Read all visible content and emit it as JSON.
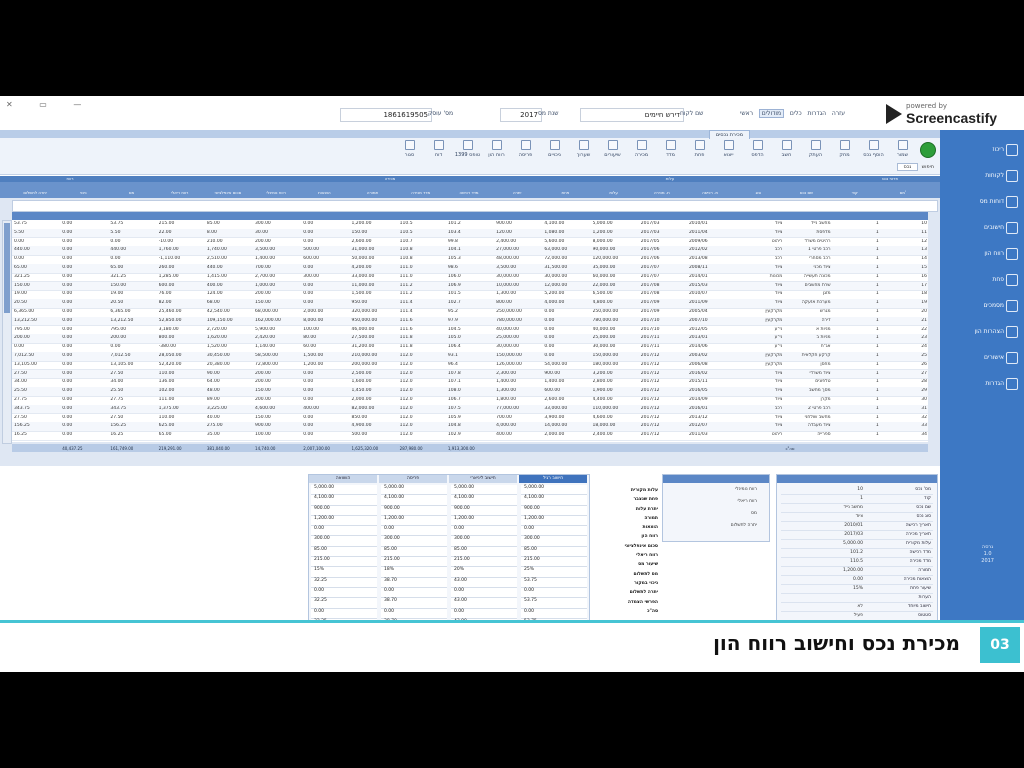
{
  "title_bar": {
    "field_id_label": "מס' עוסק",
    "field_id_value": "1861619505",
    "field_year_label": "שנת מס",
    "field_year_value": "2017",
    "field_name_label": "שם לקוח",
    "field_name_value": "דירש חיימים",
    "menu": [
      "ראשי",
      "מודולים",
      "כלים",
      "הגדרות",
      "עזרה"
    ]
  },
  "logo": {
    "small": "powered by",
    "big": "Screencastify"
  },
  "sidebar": {
    "items": [
      "ריכוז",
      "לקוחות",
      "דוחות מס",
      "חישובים",
      "רווח הון",
      "פחת",
      "מסמכים",
      "הצהרות הון",
      "אישורים",
      "הגדרות"
    ],
    "footer": [
      "גרסה",
      "1.0",
      "2017"
    ]
  },
  "ribbon": {
    "active_tab": "מכירת נכסים",
    "buttons": [
      "שמור",
      "הוסף נכס",
      "מחק",
      "העתק",
      "חשב",
      "הדפס",
      "ייצוא",
      "פחת",
      "מדד",
      "מכירה",
      "שיעורים",
      "שערוך",
      "ניכויים",
      "פריסה",
      "רווח הון",
      "טופס 1399",
      "דוח",
      "סגור"
    ],
    "search_label": "חיפוש",
    "search_value": "נכס"
  },
  "grid": {
    "group_headers": [
      "פרטי נכס",
      "עלות",
      "מכירה",
      "רווח"
    ],
    "columns": [
      "מס'",
      "קוד",
      "שם נכס",
      "סוג",
      "ת. רכישה",
      "ת. מכירה",
      "עלות",
      "פחת",
      "יתרה",
      "מדד רכישה",
      "מדד מכירה",
      "תמורה",
      "הוצאות",
      "רווח נומינלי",
      "סכום אינפלציוני",
      "רווח ריאלי",
      "מס",
      "ניכוי",
      "יתרה לתשלום"
    ],
    "rows": [
      [
        "10",
        "1",
        "מחשב נייד",
        "ציוד",
        "2010/01",
        "2017/03",
        "5,000.00",
        "4,100.00",
        "900.00",
        "101.2",
        "110.5",
        "1,200.00",
        "0.00",
        "300.00",
        "85.00",
        "215.00",
        "53.75",
        "0.00",
        "53.75"
      ],
      [
        "11",
        "1",
        "מדפסת",
        "ציוד",
        "2011/04",
        "2017/03",
        "1,200.00",
        "1,080.00",
        "120.00",
        "103.4",
        "110.5",
        "150.00",
        "0.00",
        "30.00",
        "8.00",
        "22.00",
        "5.50",
        "0.00",
        "5.50"
      ],
      [
        "12",
        "1",
        "רהיטים משרד",
        "ריהוט",
        "2009/06",
        "2017/05",
        "8,000.00",
        "5,600.00",
        "2,400.00",
        "99.8",
        "110.7",
        "2,600.00",
        "0.00",
        "200.00",
        "210.00",
        "-10.00",
        "0.00",
        "0.00",
        "0.00"
      ],
      [
        "13",
        "1",
        "רכב פרטי 1",
        "רכב",
        "2012/02",
        "2017/06",
        "90,000.00",
        "63,000.00",
        "27,000.00",
        "104.1",
        "110.8",
        "31,000.00",
        "500.00",
        "3,500.00",
        "1,740.00",
        "1,760.00",
        "440.00",
        "0.00",
        "440.00"
      ],
      [
        "14",
        "1",
        "רכב מסחרי",
        "רכב",
        "2013/08",
        "2017/06",
        "120,000.00",
        "72,000.00",
        "48,000.00",
        "105.3",
        "110.8",
        "50,000.00",
        "600.00",
        "1,400.00",
        "2,510.00",
        "-1,110.00",
        "0.00",
        "0.00",
        "0.00"
      ],
      [
        "15",
        "1",
        "ציוד מכני",
        "ציוד",
        "2008/11",
        "2017/07",
        "35,000.00",
        "31,500.00",
        "3,500.00",
        "98.6",
        "111.0",
        "4,200.00",
        "0.00",
        "700.00",
        "440.00",
        "260.00",
        "65.00",
        "0.00",
        "65.00"
      ],
      [
        "16",
        "1",
        "מכונה תעשייה",
        "מכונות",
        "2014/01",
        "2017/07",
        "60,000.00",
        "30,000.00",
        "30,000.00",
        "106.0",
        "111.0",
        "33,000.00",
        "300.00",
        "2,700.00",
        "1,415.00",
        "1,285.00",
        "321.25",
        "0.00",
        "321.25"
      ],
      [
        "17",
        "1",
        "שרת מחשבים",
        "ציוד",
        "2015/03",
        "2017/08",
        "22,000.00",
        "12,000.00",
        "10,000.00",
        "106.9",
        "111.2",
        "11,000.00",
        "0.00",
        "1,000.00",
        "400.00",
        "600.00",
        "150.00",
        "0.00",
        "150.00"
      ],
      [
        "18",
        "1",
        "מזגן",
        "ציוד",
        "2010/07",
        "2017/08",
        "6,500.00",
        "5,200.00",
        "1,300.00",
        "101.5",
        "111.2",
        "1,500.00",
        "0.00",
        "200.00",
        "124.00",
        "76.00",
        "19.00",
        "0.00",
        "19.00"
      ],
      [
        "19",
        "1",
        "מערכת אזעקה",
        "ציוד",
        "2011/09",
        "2017/09",
        "4,800.00",
        "4,000.00",
        "800.00",
        "102.7",
        "111.4",
        "950.00",
        "0.00",
        "150.00",
        "68.00",
        "82.00",
        "20.50",
        "0.00",
        "20.50"
      ],
      [
        "20",
        "1",
        "מגרש",
        "מקרקעין",
        "2005/04",
        "2017/09",
        "250,000.00",
        "0.00",
        "250,000.00",
        "95.2",
        "111.4",
        "320,000.00",
        "2,000.00",
        "68,000.00",
        "42,540.00",
        "25,460.00",
        "6,365.00",
        "0.00",
        "6,365.00"
      ],
      [
        "21",
        "1",
        "דירה",
        "מקרקעין",
        "2007/10",
        "2017/10",
        "780,000.00",
        "0.00",
        "780,000.00",
        "97.9",
        "111.6",
        "950,000.00",
        "8,000.00",
        "162,000.00",
        "109,150.00",
        "52,850.00",
        "13,212.50",
        "0.00",
        "13,212.50"
      ],
      [
        "22",
        "1",
        "מניות א",
        "ני\"ע",
        "2012/05",
        "2017/10",
        "40,000.00",
        "0.00",
        "40,000.00",
        "104.5",
        "111.6",
        "46,000.00",
        "100.00",
        "5,900.00",
        "2,720.00",
        "3,180.00",
        "795.00",
        "0.00",
        "795.00"
      ],
      [
        "23",
        "1",
        "מניות ב",
        "ני\"ע",
        "2013/01",
        "2017/11",
        "25,000.00",
        "0.00",
        "25,000.00",
        "105.0",
        "111.8",
        "27,500.00",
        "80.00",
        "2,420.00",
        "1,620.00",
        "800.00",
        "200.00",
        "0.00",
        "200.00"
      ],
      [
        "24",
        "1",
        "אג\"ח",
        "ני\"ע",
        "2014/06",
        "2017/11",
        "30,000.00",
        "0.00",
        "30,000.00",
        "106.4",
        "111.8",
        "31,200.00",
        "60.00",
        "1,140.00",
        "1,520.00",
        "-380.00",
        "0.00",
        "0.00",
        "0.00"
      ],
      [
        "25",
        "1",
        "קרקע חקלאית",
        "מקרקעין",
        "2003/02",
        "2017/12",
        "150,000.00",
        "0.00",
        "150,000.00",
        "93.1",
        "112.0",
        "210,000.00",
        "1,500.00",
        "58,500.00",
        "30,450.00",
        "28,050.00",
        "7,012.50",
        "0.00",
        "7,012.50"
      ],
      [
        "26",
        "1",
        "מחסן",
        "מקרקעין",
        "2006/08",
        "2017/12",
        "180,000.00",
        "54,000.00",
        "126,000.00",
        "96.4",
        "112.0",
        "200,000.00",
        "1,200.00",
        "72,800.00",
        "20,380.00",
        "52,420.00",
        "13,105.00",
        "0.00",
        "13,105.00"
      ],
      [
        "27",
        "1",
        "ציוד משרדי",
        "ציוד",
        "2016/02",
        "2017/12",
        "3,200.00",
        "900.00",
        "2,300.00",
        "107.8",
        "112.0",
        "2,500.00",
        "0.00",
        "200.00",
        "90.00",
        "110.00",
        "27.50",
        "0.00",
        "27.50"
      ],
      [
        "28",
        "1",
        "טלפונים",
        "ציוד",
        "2015/11",
        "2017/12",
        "2,800.00",
        "1,400.00",
        "1,400.00",
        "107.1",
        "112.0",
        "1,600.00",
        "0.00",
        "200.00",
        "64.00",
        "136.00",
        "34.00",
        "0.00",
        "34.00"
      ],
      [
        "29",
        "1",
        "מסך מחשב",
        "ציוד",
        "2016/05",
        "2017/12",
        "1,900.00",
        "600.00",
        "1,300.00",
        "108.0",
        "112.0",
        "1,450.00",
        "0.00",
        "150.00",
        "48.00",
        "102.00",
        "25.50",
        "0.00",
        "25.50"
      ],
      [
        "30",
        "1",
        "מקרן",
        "ציוד",
        "2014/09",
        "2017/12",
        "4,400.00",
        "2,600.00",
        "1,800.00",
        "106.7",
        "112.0",
        "2,000.00",
        "0.00",
        "200.00",
        "89.00",
        "111.00",
        "27.75",
        "0.00",
        "27.75"
      ],
      [
        "31",
        "1",
        "רכב פרטי 2",
        "רכב",
        "2016/01",
        "2017/12",
        "110,000.00",
        "33,000.00",
        "77,000.00",
        "107.5",
        "112.0",
        "82,000.00",
        "400.00",
        "4,600.00",
        "3,225.00",
        "1,375.00",
        "343.75",
        "0.00",
        "343.75"
      ],
      [
        "32",
        "1",
        "מחשב שולחני",
        "ציוד",
        "2013/12",
        "2017/12",
        "4,600.00",
        "3,900.00",
        "700.00",
        "105.9",
        "112.0",
        "850.00",
        "0.00",
        "150.00",
        "40.00",
        "110.00",
        "27.50",
        "0.00",
        "27.50"
      ],
      [
        "33",
        "1",
        "ציוד מעבדה",
        "ציוד",
        "2012/07",
        "2017/12",
        "18,000.00",
        "14,000.00",
        "4,000.00",
        "104.8",
        "112.0",
        "4,900.00",
        "0.00",
        "900.00",
        "275.00",
        "625.00",
        "156.25",
        "0.00",
        "156.25"
      ],
      [
        "34",
        "1",
        "ספרייה",
        "ריהוט",
        "2011/03",
        "2017/12",
        "2,400.00",
        "2,000.00",
        "400.00",
        "102.9",
        "112.0",
        "500.00",
        "0.00",
        "100.00",
        "35.00",
        "65.00",
        "16.25",
        "0.00",
        "16.25"
      ]
    ],
    "totals": [
      "סה\"כ",
      "1,913,300.00",
      "287,980.00",
      "1,625,320.00",
      "2,007,100.00",
      "14,740.00",
      "381,040.00",
      "219,291.00",
      "161,749.00",
      "40,437.25"
    ]
  },
  "details_panel": {
    "rows": [
      {
        "k": "מס' נכס",
        "v": "10"
      },
      {
        "k": "קוד",
        "v": "1"
      },
      {
        "k": "שם נכס",
        "v": "מחשב נייד"
      },
      {
        "k": "סוג נכס",
        "v": "ציוד"
      },
      {
        "k": "תאריך רכישה",
        "v": "2010/01"
      },
      {
        "k": "תאריך מכירה",
        "v": "2017/03"
      },
      {
        "k": "עלות מקורית",
        "v": "5,000.00"
      },
      {
        "k": "מדד רכישה",
        "v": "101.2"
      },
      {
        "k": "מדד מכירה",
        "v": "110.5"
      },
      {
        "k": "תמורה",
        "v": "1,200.00"
      },
      {
        "k": "הוצאות מכירה",
        "v": "0.00"
      },
      {
        "k": "שיעור פחת",
        "v": "15%"
      },
      {
        "k": "הערות",
        "v": ""
      },
      {
        "k": "חישוב מיוחד",
        "v": "לא"
      },
      {
        "k": "סטטוס",
        "v": "פעיל"
      }
    ]
  },
  "mid_panel": {
    "lines": [
      "רווח נומינלי",
      "רווח ריאלי",
      "מס",
      "יתרה לתשלום"
    ]
  },
  "calc_labels": [
    "עלות מקורית",
    "פחת שנצבר",
    "יתרת עלות",
    "תמורה",
    "הוצאות",
    "רווח הון",
    "סכום אינפלציוני",
    "רווח ריאלי",
    "שיעור מס",
    "מס לתשלום",
    "ניכוי במקור",
    "יתרה לתשלום",
    "הפרשי הצמדה",
    "סה\"כ"
  ],
  "compare_panel": {
    "tabs": [
      "חישוב רגיל",
      "חישוב ליניארי",
      "פריסה",
      "השוואה"
    ],
    "columns": [
      [
        "5,000.00",
        "4,100.00",
        "900.00",
        "1,200.00",
        "0.00",
        "300.00",
        "85.00",
        "215.00",
        "25%",
        "53.75",
        "0.00",
        "53.75",
        "0.00",
        "53.75"
      ],
      [
        "5,000.00",
        "4,100.00",
        "900.00",
        "1,200.00",
        "0.00",
        "300.00",
        "85.00",
        "215.00",
        "20%",
        "43.00",
        "0.00",
        "43.00",
        "0.00",
        "43.00"
      ],
      [
        "5,000.00",
        "4,100.00",
        "900.00",
        "1,200.00",
        "0.00",
        "300.00",
        "85.00",
        "215.00",
        "18%",
        "38.70",
        "0.00",
        "38.70",
        "0.00",
        "38.70"
      ],
      [
        "5,000.00",
        "4,100.00",
        "900.00",
        "1,200.00",
        "0.00",
        "300.00",
        "85.00",
        "215.00",
        "15%",
        "32.25",
        "0.00",
        "32.25",
        "0.00",
        "32.25"
      ]
    ]
  },
  "caption": {
    "number": "03",
    "text": "מכירת נכס וחישוב רווח הון"
  }
}
